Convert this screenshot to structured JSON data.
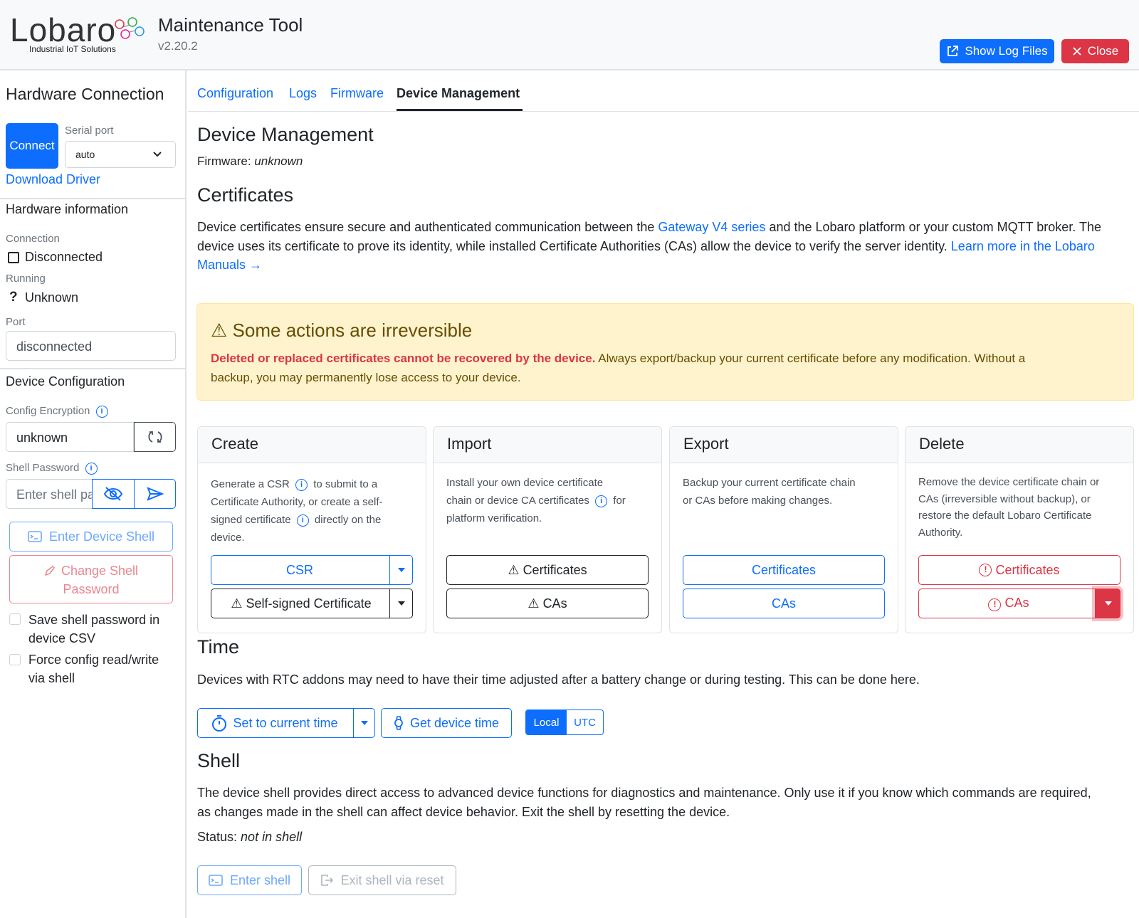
{
  "header": {
    "logo_text": "Lobaro",
    "logo_tagline": "Industrial IoT Solutions",
    "title": "Maintenance Tool",
    "version": "v2.20.2",
    "show_log_files": "Show Log Files",
    "close": "Close"
  },
  "sidebar": {
    "title": "Hardware Connection",
    "connect": "Connect",
    "serial_port_label": "Serial port",
    "serial_port_value": "auto",
    "download_driver": "Download Driver",
    "hw_info_title": "Hardware information",
    "connection_label": "Connection",
    "connection_value": "Disconnected",
    "running_label": "Running",
    "running_value": "Unknown",
    "port_label": "Port",
    "port_value": "disconnected",
    "device_config_title": "Device Configuration",
    "config_encryption_label": "Config Encryption",
    "config_encryption_value": "unknown",
    "shell_password_label": "Shell Password",
    "shell_password_placeholder": "Enter shell password",
    "enter_device_shell": "Enter Device Shell",
    "change_shell_password_1": "Change Shell",
    "change_shell_password_2": "Password",
    "save_pw_1": "Save shell password in",
    "save_pw_2": "device CSV",
    "force_cfg_1": "Force config read/write",
    "force_cfg_2": "via shell"
  },
  "tabs": [
    "Configuration",
    "Logs",
    "Firmware",
    "Device Management"
  ],
  "main": {
    "title": "Device Management",
    "firmware_label": "Firmware:",
    "firmware_value": "unknown",
    "certificates_title": "Certificates",
    "cert_desc_1": "Device certificates ensure secure and authenticated communication between the ",
    "cert_link_gateway": "Gateway V4 series",
    "cert_desc_2": " and the Lobaro platform or your custom MQTT broker. The",
    "cert_desc_3": "device uses its certificate to prove its identity, while installed Certificate Authorities (CAs) allow the device to verify the server identity. ",
    "cert_link_learn_1": "Learn more in the Lobaro",
    "cert_link_learn_2": "Manuals →",
    "warning_title": "Some actions are irreversible",
    "warning_bold": "Deleted or replaced certificates cannot be recovered by the device.",
    "warning_text_1": " Always export/backup your current certificate before any modification. Without a",
    "warning_text_2": "backup, you may permanently lose access to your device.",
    "cards": {
      "create": {
        "title": "Create",
        "t1": "Generate a CSR",
        "t2": "to submit to a",
        "t3": "Certificate Authority, or create a self-",
        "t4": "signed certificate",
        "t5": "directly on the",
        "t6": "device.",
        "btn1": "CSR",
        "btn2": "Self-signed Certificate"
      },
      "import": {
        "title": "Import",
        "t1": "Install your own device certificate",
        "t2": "chain or device CA certificates",
        "t3": "for",
        "t4": "platform verification.",
        "btn1": "Certificates",
        "btn2": "CAs"
      },
      "export": {
        "title": "Export",
        "t1": "Backup your current certificate chain",
        "t2": "or CAs before making changes.",
        "btn1": "Certificates",
        "btn2": "CAs"
      },
      "delete": {
        "title": "Delete",
        "t1": "Remove the device certificate chain or",
        "t2": "CAs (irreversible without backup), or",
        "t3": "restore the default Lobaro Certificate",
        "t4": "Authority.",
        "btn1": "Certificates",
        "btn2": "CAs"
      }
    },
    "time_title": "Time",
    "time_desc": "Devices with RTC addons may need to have their time adjusted after a battery change or during testing. This can be done here.",
    "set_current_time": "Set to current time",
    "get_device_time": "Get device time",
    "tz_local": "Local",
    "tz_utc": "UTC",
    "shell_title": "Shell",
    "shell_desc_1": "The device shell provides direct access to advanced device functions for diagnostics and maintenance. Only use it if you know which commands are required,",
    "shell_desc_2": "as changes made in the shell can affect device behavior. Exit the shell by resetting the device.",
    "status_label": "Status:",
    "status_value": "not in shell",
    "enter_shell": "Enter shell",
    "exit_shell": "Exit shell via reset"
  },
  "colors": {
    "primary": "#0d6efd",
    "danger": "#dc3545",
    "warning_bg": "#fff3cd",
    "warning_text": "#664d03"
  }
}
